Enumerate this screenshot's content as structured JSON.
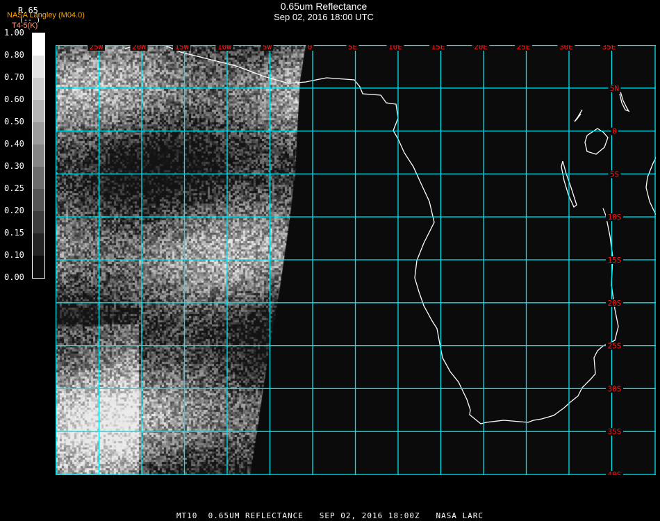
{
  "header": {
    "title": "0.65um Reflectance",
    "subtitle": "Sep 02, 2016 18:00 UTC"
  },
  "legend": {
    "product": "R.65",
    "source": "NASA Langley (M04.0)",
    "units": "(-- )",
    "secondary": "T4-5(K)",
    "ticks": [
      "1.00",
      "0.80",
      "0.70",
      "0.60",
      "0.50",
      "0.40",
      "0.30",
      "0.25",
      "0.20",
      "0.15",
      "0.10",
      "0.00"
    ],
    "band_colors": [
      "#ffffff",
      "#e4e4e4",
      "#cccccc",
      "#b4b4b4",
      "#9c9c9c",
      "#848484",
      "#6c6c6c",
      "#555555",
      "#3d3d3d",
      "#242424",
      "#0c0c0c"
    ]
  },
  "map": {
    "lon_labels": [
      "25W",
      "20W",
      "15W",
      "10W",
      "5W",
      "0",
      "5E",
      "10E",
      "15E",
      "20E",
      "25E",
      "30E",
      "35E"
    ],
    "lat_labels": [
      "5N",
      "0",
      "5S",
      "10S",
      "15S",
      "20S",
      "25S",
      "30S",
      "35S",
      "40S"
    ],
    "grid_color": "#00e5ee",
    "label_color": "#ff1a1a",
    "coast_color": "#ffffff"
  },
  "footer": {
    "text": "MT10  0.65UM REFLECTANCE   SEP 02, 2016 18:00Z   NASA LARC"
  }
}
